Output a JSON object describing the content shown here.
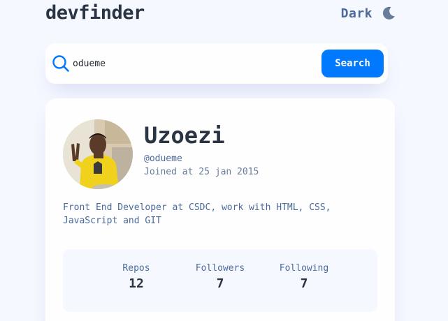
{
  "header": {
    "logo": "devfinder",
    "theme_label": "Dark"
  },
  "search": {
    "value": "odueme",
    "button_label": "Search"
  },
  "profile": {
    "name": "Uzoezi",
    "login": "@odueme",
    "joined": "Joined at 25 jan 2015",
    "bio_line1": "Front End Developer at CSDC, work with HTML, CSS,",
    "bio_line2": "JavaScript and GIT",
    "avatar_alt": "user avatar"
  },
  "stats": [
    {
      "label": "Repos",
      "value": "12"
    },
    {
      "label": "Followers",
      "value": "7"
    },
    {
      "label": "Following",
      "value": "7"
    }
  ],
  "colors": {
    "accent": "#0079ff",
    "background": "#f6f8ff",
    "card": "#fefefe",
    "heading": "#2b3442",
    "text": "#4b6a9b"
  },
  "icons": {
    "theme": "moon-icon",
    "search": "search-icon"
  }
}
